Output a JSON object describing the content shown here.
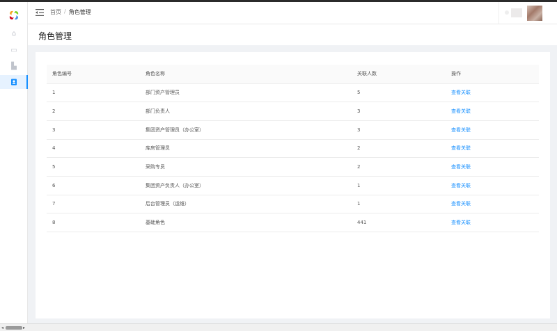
{
  "breadcrumb": {
    "home": "首页",
    "separator": "/",
    "current": "角色管理"
  },
  "page": {
    "title": "角色管理"
  },
  "sidebar": {
    "items": [
      {
        "icon": "home-icon"
      },
      {
        "icon": "document-icon"
      },
      {
        "icon": "chart-icon"
      },
      {
        "icon": "user-badge-icon",
        "active": true
      }
    ]
  },
  "table": {
    "headers": {
      "id": "角色编号",
      "name": "角色名称",
      "count": "关联人数",
      "action": "操作"
    },
    "rows": [
      {
        "id": "1",
        "name": "部门资产管理员",
        "count": "5",
        "action": "查看关联"
      },
      {
        "id": "2",
        "name": "部门负责人",
        "count": "3",
        "action": "查看关联"
      },
      {
        "id": "3",
        "name": "集团资产管理员（办公室）",
        "count": "3",
        "action": "查看关联"
      },
      {
        "id": "4",
        "name": "库房管理员",
        "count": "2",
        "action": "查看关联"
      },
      {
        "id": "5",
        "name": "采购专员",
        "count": "2",
        "action": "查看关联"
      },
      {
        "id": "6",
        "name": "集团资产负责人（办公室）",
        "count": "1",
        "action": "查看关联"
      },
      {
        "id": "7",
        "name": "后台管理员（运维）",
        "count": "1",
        "action": "查看关联"
      },
      {
        "id": "8",
        "name": "基础角色",
        "count": "441",
        "action": "查看关联"
      }
    ]
  },
  "colors": {
    "accent": "#1890ff",
    "background": "#f0f2f5"
  }
}
